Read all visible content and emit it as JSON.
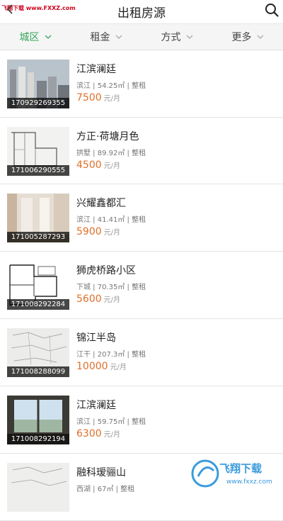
{
  "header": {
    "title": "出租房源",
    "watermark": "飞翔下载 www.FXXZ.com"
  },
  "filters": [
    {
      "label": "城区",
      "active": true
    },
    {
      "label": "租金",
      "active": false
    },
    {
      "label": "方式",
      "active": false
    },
    {
      "label": "更多",
      "active": false
    }
  ],
  "listings": [
    {
      "code": "170929269355",
      "name": "江滨澜廷",
      "meta": "滨江 | 54.25㎡ | 整租",
      "price": "7500",
      "unit": "元/月",
      "thumb": "towers"
    },
    {
      "code": "171006290555",
      "name": "方正·荷塘月色",
      "meta": "拱墅 | 89.92㎡ | 整租",
      "price": "4500",
      "unit": "元/月",
      "thumb": "floorplan"
    },
    {
      "code": "171005287293",
      "name": "兴耀鑫都汇",
      "meta": "滨江 | 41.41㎡ | 整租",
      "price": "5900",
      "unit": "元/月",
      "thumb": "room"
    },
    {
      "code": "171008292284",
      "name": "狮虎桥路小区",
      "meta": "下城 | 70.35㎡ | 整租",
      "price": "5600",
      "unit": "元/月",
      "thumb": "floorplan2"
    },
    {
      "code": "171008288099",
      "name": "锦江半岛",
      "meta": "江干 | 207.3㎡ | 整租",
      "price": "10000",
      "unit": "元/月",
      "thumb": "sketch"
    },
    {
      "code": "171008292194",
      "name": "江滨澜廷",
      "meta": "滨江 | 59.75㎡ | 整租",
      "price": "6300",
      "unit": "元/月",
      "thumb": "window"
    },
    {
      "code": "",
      "name": "融科瑷骊山",
      "meta": "西湖 | 67㎡ | 整租",
      "price": "",
      "unit": "",
      "thumb": "sketch"
    }
  ],
  "bottom_watermark": {
    "brand": "飞翔下载",
    "url": "www.fxxz.com"
  },
  "colors": {
    "accent": "#35a55a",
    "price": "#e06f2a"
  }
}
